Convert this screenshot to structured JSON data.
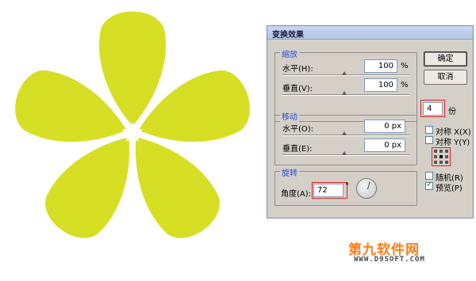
{
  "dialog": {
    "title": "变换效果",
    "scale": {
      "group_title": "缩放",
      "horizontal_label": "水平(H):",
      "horizontal_value": "100",
      "vertical_label": "垂直(V):",
      "vertical_value": "100",
      "unit": "%"
    },
    "move": {
      "group_title": "移动",
      "horizontal_label": "水平(O):",
      "horizontal_value": "0 px",
      "vertical_label": "垂直(E):",
      "vertical_value": "0 px"
    },
    "rotate": {
      "group_title": "旋转",
      "angle_label": "角度(A):",
      "angle_value": "72",
      "degree_symbol": "°"
    },
    "buttons": {
      "ok": "确定",
      "cancel": "取消"
    },
    "copies": {
      "value": "4",
      "unit": "份"
    },
    "checkboxes": {
      "reflect_x": {
        "label": "对称 X(X)",
        "checked": false
      },
      "reflect_y": {
        "label": "对称 Y(Y)",
        "checked": false
      },
      "random": {
        "label": "随机(R)",
        "checked": false
      },
      "preview": {
        "label": "预览(P)",
        "checked": true
      }
    }
  },
  "watermark": {
    "brand": "第九软件网",
    "url": "WWW.D9SOFT.COM"
  },
  "colors": {
    "flower": "#d6df24",
    "highlight": "#e02020",
    "group_title": "#2d47d8"
  }
}
